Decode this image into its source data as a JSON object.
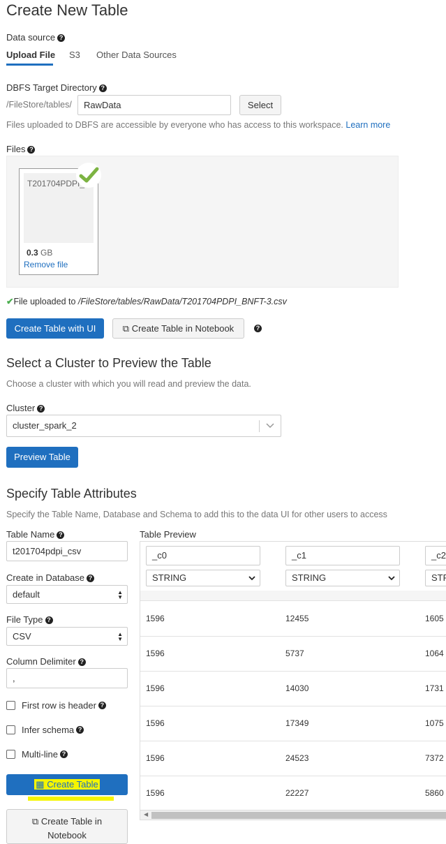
{
  "page": {
    "title": "Create New Table"
  },
  "datasource": {
    "label": "Data source",
    "tabs": [
      {
        "label": "Upload File",
        "active": true
      },
      {
        "label": "S3",
        "active": false
      },
      {
        "label": "Other Data Sources",
        "active": false
      }
    ]
  },
  "dbfs": {
    "label": "DBFS Target Directory",
    "prefix": "/FileStore/tables/",
    "value": "RawData",
    "select_button": "Select",
    "note": "Files uploaded to DBFS are accessible by everyone who has access to this workspace.",
    "learn_more": "Learn more"
  },
  "files": {
    "label": "Files",
    "card": {
      "name": "T201704PDPI_",
      "size_value": "0.3",
      "size_unit": "GB",
      "remove": "Remove file"
    },
    "uploaded_prefix": "File uploaded to",
    "uploaded_path": "/FileStore/tables/RawData/T201704PDPI_BNFT-3.csv"
  },
  "actions": {
    "create_ui": "Create Table with UI",
    "create_notebook": "Create Table in Notebook"
  },
  "cluster_section": {
    "title": "Select a Cluster to Preview the Table",
    "subtitle": "Choose a cluster with which you will read and preview the data.",
    "cluster_label": "Cluster",
    "cluster_value": "cluster_spark_2",
    "preview_button": "Preview Table"
  },
  "attributes": {
    "title": "Specify Table Attributes",
    "subtitle": "Specify the Table Name, Database and Schema to add this to the data UI for other users to access",
    "table_name_label": "Table Name",
    "table_name_value": "t201704pdpi_csv",
    "database_label": "Create in Database",
    "database_value": "default",
    "file_type_label": "File Type",
    "file_type_value": "CSV",
    "delimiter_label": "Column Delimiter",
    "delimiter_value": ",",
    "first_row_header": "First row is header",
    "infer_schema": "Infer schema",
    "multi_line": "Multi-line",
    "create_table": "Create Table",
    "create_in_notebook_line1": "Create Table in",
    "create_in_notebook_line2": "Notebook"
  },
  "preview": {
    "label": "Table Preview",
    "columns": [
      {
        "name": "_c0",
        "type": "STRING"
      },
      {
        "name": "_c1",
        "type": "STRING"
      },
      {
        "name": "_c2",
        "type": "STR"
      }
    ],
    "rows": [
      [
        "1596",
        "12455",
        "1605"
      ],
      [
        "1596",
        "5737",
        "1064"
      ],
      [
        "1596",
        "14030",
        "1731"
      ],
      [
        "1596",
        "17349",
        "1075"
      ],
      [
        "1596",
        "24523",
        "7372"
      ],
      [
        "1596",
        "22227",
        "5860"
      ]
    ]
  },
  "colors": {
    "primary": "#1f6fbf",
    "success": "#7cb342",
    "highlight": "#f5f500"
  }
}
